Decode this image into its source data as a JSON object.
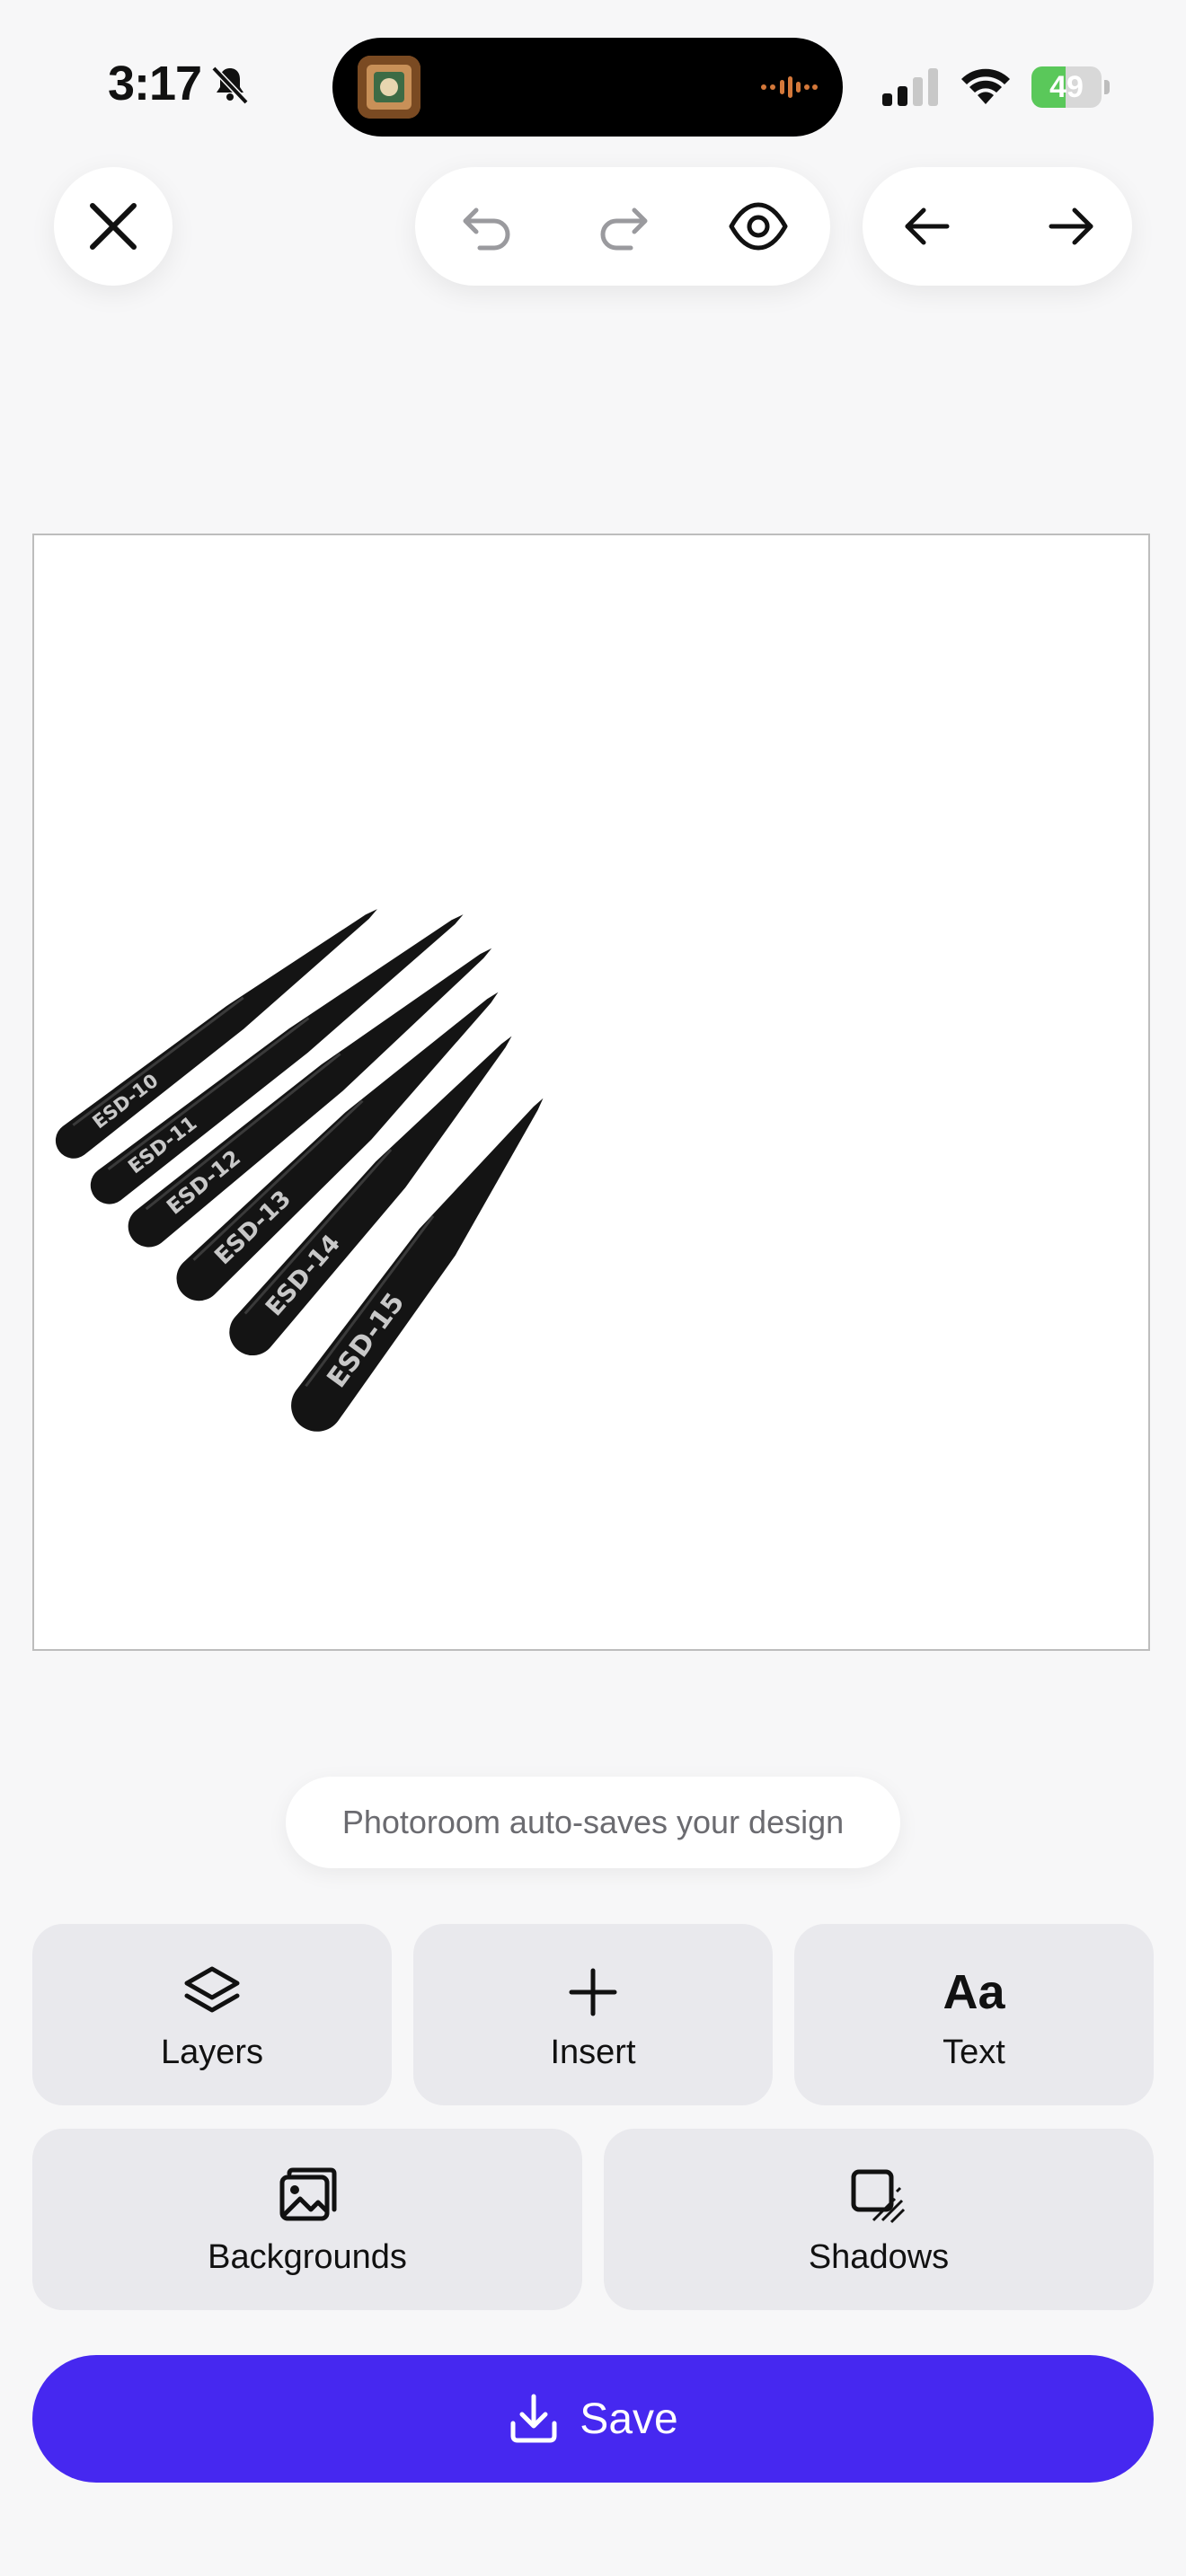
{
  "status_bar": {
    "time": "3:17",
    "battery": "49",
    "battery_level": 0.49,
    "icons": [
      "bell-slash-icon",
      "signal-icon",
      "wifi-icon",
      "battery-icon"
    ]
  },
  "toolbar": {
    "icons": [
      "close-icon",
      "undo-icon",
      "redo-icon",
      "eye-icon",
      "arrow-left-icon",
      "arrow-right-icon"
    ]
  },
  "canvas": {
    "tweezers": [
      {
        "label": "ESD-10"
      },
      {
        "label": "ESD-11"
      },
      {
        "label": "ESD-12"
      },
      {
        "label": "ESD-13"
      },
      {
        "label": "ESD-14"
      },
      {
        "label": "ESD-15"
      }
    ]
  },
  "toast": {
    "text": "Photoroom auto-saves your design"
  },
  "tools": {
    "layers": "Layers",
    "insert": "Insert",
    "text": "Text",
    "text_icon": "Aa",
    "backgrounds": "Backgrounds",
    "shadows": "Shadows"
  },
  "save": {
    "label": "Save"
  },
  "colors": {
    "accent": "#4628f0",
    "tile": "#e9e9ed",
    "battery": "#5ac85a"
  }
}
